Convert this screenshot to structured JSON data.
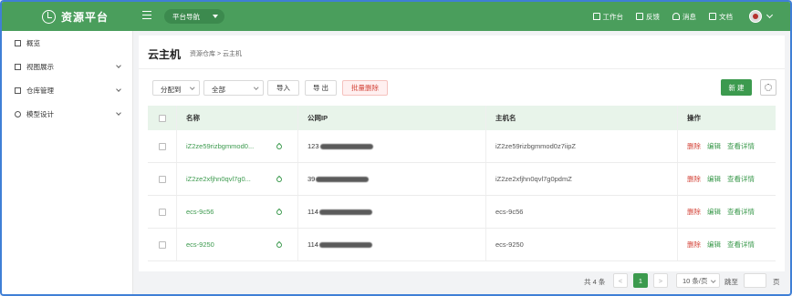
{
  "header": {
    "app_title": "资源平台",
    "nav_select": "平台导航",
    "links": [
      {
        "label": "工作台",
        "icon": "home-icon"
      },
      {
        "label": "反馈",
        "icon": "feedback-icon"
      },
      {
        "label": "消息",
        "icon": "bell-icon"
      },
      {
        "label": "文档",
        "icon": "document-icon"
      }
    ]
  },
  "sidebar": {
    "items": [
      {
        "label": "概览",
        "icon": "home-icon",
        "expandable": false
      },
      {
        "label": "视图展示",
        "icon": "chart-icon",
        "expandable": true
      },
      {
        "label": "仓库管理",
        "icon": "list-icon",
        "expandable": true
      },
      {
        "label": "模型设计",
        "icon": "compass-icon",
        "expandable": true
      }
    ]
  },
  "page": {
    "title": "云主机",
    "breadcrumb": "资源仓库 > 云主机"
  },
  "toolbar": {
    "assign_select": "分配到",
    "filter_select": "全部",
    "import_label": "导入",
    "export_label": "导 出",
    "batch_delete_label": "批量删除",
    "new_label": "新 建"
  },
  "table": {
    "headers": [
      "名称",
      "公网IP",
      "主机名",
      "操作"
    ],
    "rows": [
      {
        "name": "iZ2ze59rizbgmmod0...",
        "ip_prefix": "123",
        "hostname": "iZ2ze59rizbgmmod0z7iipZ"
      },
      {
        "name": "iZ2ze2xfjhn0qvl7g0...",
        "ip_prefix": "39",
        "hostname": "iZ2ze2xfjhn0qvl7g0pdmZ"
      },
      {
        "name": "ecs-9c56",
        "ip_prefix": "114",
        "hostname": "ecs-9c56"
      },
      {
        "name": "ecs-9250",
        "ip_prefix": "114",
        "hostname": "ecs-9250"
      }
    ],
    "actions": {
      "delete": "删除",
      "edit": "编辑",
      "detail": "查看详情"
    }
  },
  "pagination": {
    "total": "共 4 条",
    "prev": "<",
    "current": "1",
    "next": ">",
    "page_size": "10 条/页",
    "goto_label": "跳至",
    "goto_unit": "页"
  },
  "colors": {
    "brand": "#4a9e5c",
    "accent": "#3c9a4e",
    "danger": "#d4463b"
  }
}
